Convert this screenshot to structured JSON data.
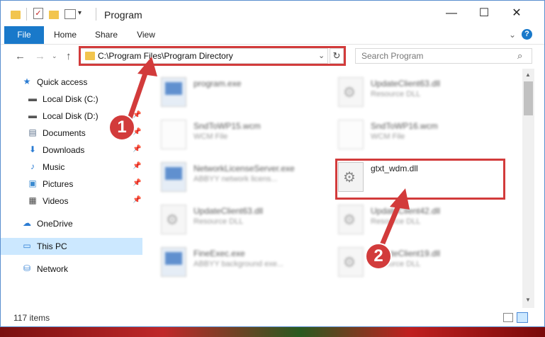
{
  "window": {
    "title": "Program",
    "min_glyph": "—",
    "max_glyph": "☐",
    "close_glyph": "✕"
  },
  "quick_access_toolbar": {
    "dropdown_glyph": "▾",
    "check_glyph": "✓"
  },
  "ribbon": {
    "tabs": [
      {
        "label": "File"
      },
      {
        "label": "Home"
      },
      {
        "label": "Share"
      },
      {
        "label": "View"
      }
    ],
    "chevron_glyph": "⌄",
    "help_glyph": "?"
  },
  "nav": {
    "back_glyph": "←",
    "forward_glyph": "→",
    "recent_glyph": "⌄",
    "up_glyph": "↑",
    "address": "C:\\Program Files\\Program Directory",
    "address_drop_glyph": "⌄",
    "refresh_glyph": "↻",
    "search_placeholder": "Search Program",
    "search_glyph": "⌕"
  },
  "sidebar": {
    "items": [
      {
        "label": "Quick access",
        "icon": "star-icon",
        "glyph": "★",
        "color": "#2b7cd3"
      },
      {
        "label": "Local Disk (C:)",
        "icon": "drive-icon",
        "glyph": "▬",
        "color": "#555555"
      },
      {
        "label": "Local Disk (D:)",
        "icon": "drive-icon",
        "glyph": "▬",
        "color": "#555555"
      },
      {
        "label": "Documents",
        "icon": "documents-icon",
        "glyph": "▤",
        "color": "#5a6f8a"
      },
      {
        "label": "Downloads",
        "icon": "downloads-icon",
        "glyph": "⬇",
        "color": "#2b7cd3"
      },
      {
        "label": "Music",
        "icon": "music-icon",
        "glyph": "♪",
        "color": "#2b7cd3"
      },
      {
        "label": "Pictures",
        "icon": "pictures-icon",
        "glyph": "▣",
        "color": "#3a8ad0"
      },
      {
        "label": "Videos",
        "icon": "videos-icon",
        "glyph": "▦",
        "color": "#444444"
      },
      {
        "label": "OneDrive",
        "icon": "onedrive-icon",
        "glyph": "☁",
        "color": "#2b7cd3"
      },
      {
        "label": "This PC",
        "icon": "computer-icon",
        "glyph": "▭",
        "color": "#2b7cd3"
      },
      {
        "label": "Network",
        "icon": "network-icon",
        "glyph": "⛁",
        "color": "#2b7cd3"
      }
    ],
    "pin_glyph": "📌"
  },
  "files": [
    {
      "name": "program.exe",
      "type": "",
      "icon": "exe"
    },
    {
      "name": "UpdateClient63.dll",
      "type": "Resource DLL",
      "icon": "dll"
    },
    {
      "name": "SndToWP15.wcm",
      "type": "WCM File",
      "icon": "doc"
    },
    {
      "name": "SndToWP16.wcm",
      "type": "WCM File",
      "icon": "doc"
    },
    {
      "name": "NetworkLicenseServer.exe",
      "type": "ABBYY network licens...",
      "icon": "exe"
    },
    {
      "name": "gtxt_wdm.dll",
      "type": "",
      "icon": "dll"
    },
    {
      "name": "UpdateClient63.dll",
      "type": "Resource DLL",
      "icon": "dll"
    },
    {
      "name": "UpdateClient42.dll",
      "type": "Resource DLL",
      "icon": "dll"
    },
    {
      "name": "FineExec.exe",
      "type": "ABBYY background exe...",
      "icon": "exe"
    },
    {
      "name": "UpdateClient19.dll",
      "type": "Resource DLL",
      "icon": "dll"
    }
  ],
  "scrollbar": {
    "up_glyph": "▲",
    "down_glyph": "▼"
  },
  "status": {
    "item_count": "117 items"
  },
  "annotations": {
    "step1": "1",
    "step2": "2",
    "color": "#d23b3b"
  }
}
